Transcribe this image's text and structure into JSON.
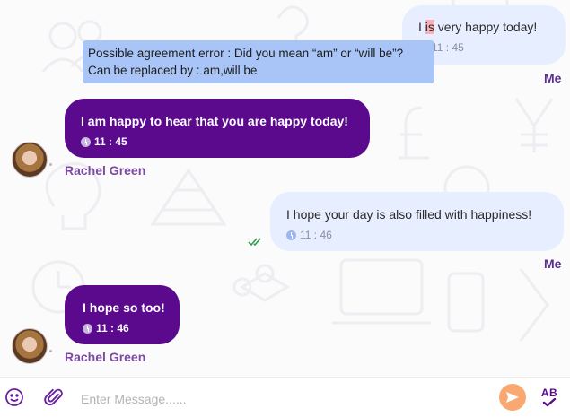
{
  "messages": [
    {
      "direction": "out",
      "text_before": "I ",
      "text_highlight": "is",
      "text_after": " very happy today!",
      "time": "11 : 45",
      "sender": "Me"
    },
    {
      "direction": "in",
      "text": "I am happy to hear that you are happy today!",
      "time": "11 : 45",
      "sender": "Rachel Green"
    },
    {
      "direction": "out",
      "text": "I hope your day is also filled with happiness!",
      "time": "11 : 46",
      "sender": "Me"
    },
    {
      "direction": "in",
      "text": "I hope so too!",
      "time": "11 : 46",
      "sender": "Rachel Green"
    }
  ],
  "grammar_tooltip": {
    "line1": "Possible agreement error : Did you mean “am” or “will be”?",
    "line2": "Can be replaced by : am,will be"
  },
  "composer": {
    "placeholder": "Enter Message......",
    "grammar_button_label": "AB"
  },
  "icons": {
    "emoji": "smiley-icon",
    "attach": "paperclip-icon",
    "send": "send-arrow-icon",
    "grammar": "ab-check-icon",
    "time": "clock-icon",
    "read": "double-check-icon"
  },
  "colors": {
    "incoming_bubble": "#5b0a8e",
    "outgoing_bubble": "#e7eeff",
    "tooltip": "#a9c4f6",
    "send_button": "#f9a872",
    "accent_purple": "#6a1fa0"
  }
}
